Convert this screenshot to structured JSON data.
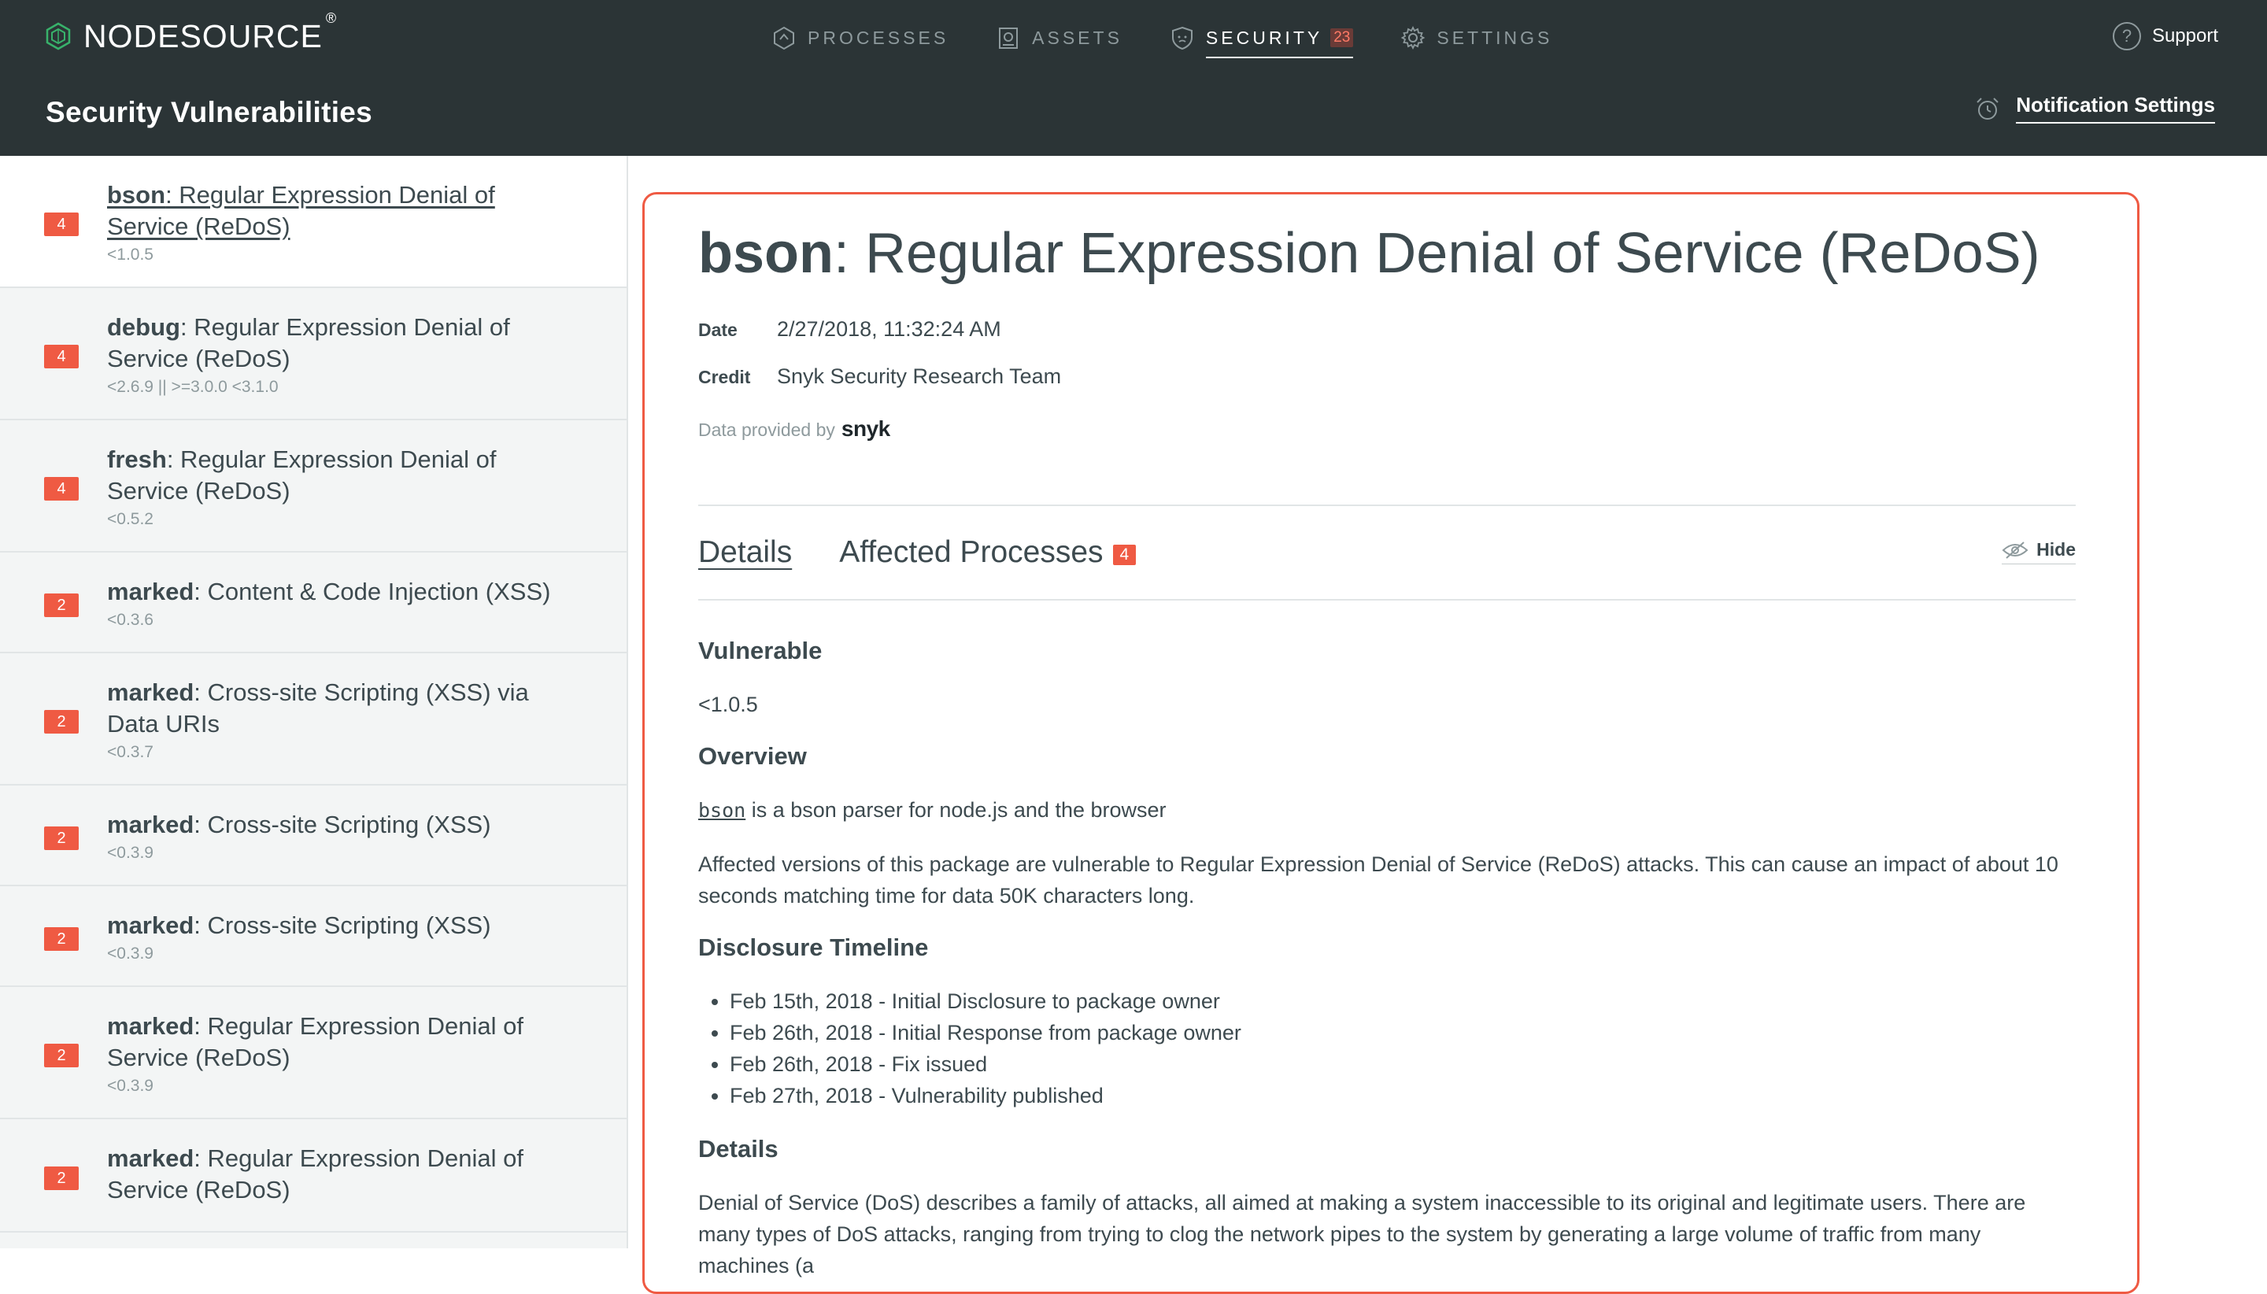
{
  "header": {
    "logo_text": "NODESOURCE",
    "logo_mark": "®",
    "nav": [
      {
        "label": "PROCESSES",
        "icon": "processes-icon"
      },
      {
        "label": "ASSETS",
        "icon": "assets-icon"
      },
      {
        "label": "SECURITY",
        "icon": "shield-icon",
        "badge": "23",
        "active": true
      },
      {
        "label": "SETTINGS",
        "icon": "gear-icon"
      }
    ],
    "support_label": "Support",
    "page_title": "Security Vulnerabilities",
    "notification_label": "Notification Settings"
  },
  "sidebar": {
    "items": [
      {
        "badge": "4",
        "pkg": "bson",
        "title": ": Regular Expression Denial of Service (ReDoS)",
        "range": "<1.0.5",
        "selected": true
      },
      {
        "badge": "4",
        "pkg": "debug",
        "title": ": Regular Expression Denial of Service (ReDoS)",
        "range": "<2.6.9 || >=3.0.0 <3.1.0"
      },
      {
        "badge": "4",
        "pkg": "fresh",
        "title": ": Regular Expression Denial of Service (ReDoS)",
        "range": "<0.5.2"
      },
      {
        "badge": "2",
        "pkg": "marked",
        "title": ": Content & Code Injection (XSS)",
        "range": "<0.3.6"
      },
      {
        "badge": "2",
        "pkg": "marked",
        "title": ": Cross-site Scripting (XSS) via Data URIs",
        "range": "<0.3.7"
      },
      {
        "badge": "2",
        "pkg": "marked",
        "title": ": Cross-site Scripting (XSS)",
        "range": "<0.3.9"
      },
      {
        "badge": "2",
        "pkg": "marked",
        "title": ": Cross-site Scripting (XSS)",
        "range": "<0.3.9"
      },
      {
        "badge": "2",
        "pkg": "marked",
        "title": ": Regular Expression Denial of Service (ReDoS)",
        "range": "<0.3.9"
      },
      {
        "badge": "2",
        "pkg": "marked",
        "title": ": Regular Expression Denial of Service (ReDoS)",
        "range": ""
      }
    ]
  },
  "detail": {
    "pkg": "bson",
    "title": ": Regular Expression Denial of Service (ReDoS)",
    "date_label": "Date",
    "date_value": "2/27/2018, 11:32:24 AM",
    "credit_label": "Credit",
    "credit_value": "Snyk Security Research Team",
    "provided_label": "Data provided by",
    "provider": "snyk",
    "tabs": {
      "details": "Details",
      "affected": "Affected Processes",
      "affected_count": "4",
      "hide": "Hide"
    },
    "vulnerable_heading": "Vulnerable",
    "vulnerable_value": "<1.0.5",
    "overview_heading": "Overview",
    "overview_pkg": "bson",
    "overview_text": " is a bson parser for node.js and the browser",
    "overview_p2": "Affected versions of this package are vulnerable to Regular Expression Denial of Service (ReDoS) attacks. This can cause an impact of about 10 seconds matching time for data 50K characters long.",
    "timeline_heading": "Disclosure Timeline",
    "timeline": [
      "Feb 15th, 2018 - Initial Disclosure to package owner",
      "Feb 26th, 2018 - Initial Response from package owner",
      "Feb 26th, 2018 - Fix issued",
      "Feb 27th, 2018 - Vulnerability published"
    ],
    "details_heading": "Details",
    "details_text": "Denial of Service (DoS) describes a family of attacks, all aimed at making a system inaccessible to its original and legitimate users. There are many types of DoS attacks, ranging from trying to clog the network pipes to the system by generating a large volume of traffic from many machines (a"
  },
  "colors": {
    "header_bg": "#2b3436",
    "accent": "#ef5a43",
    "sidebar_bg": "#f3f5f5"
  }
}
